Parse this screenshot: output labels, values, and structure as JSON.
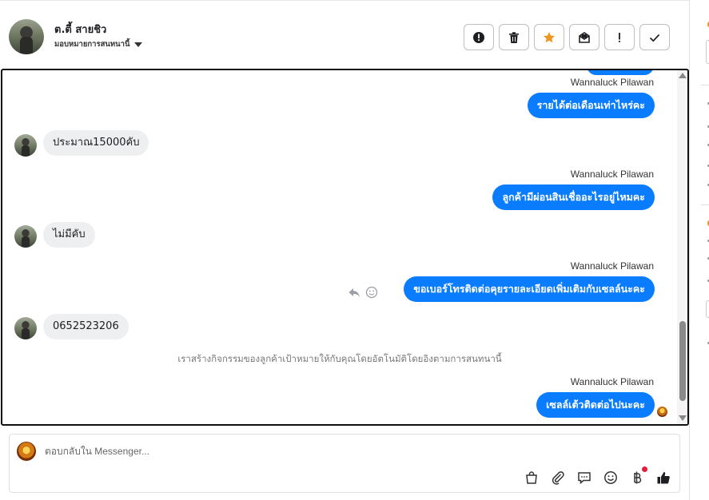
{
  "header": {
    "name": "ต.ตี้ สายชิว",
    "assign_label": "มอบหมายการสนทนานี้",
    "actions": [
      {
        "name": "report-icon"
      },
      {
        "name": "trash-icon"
      },
      {
        "name": "star-icon"
      },
      {
        "name": "mark-unread-icon"
      },
      {
        "name": "exclamation-icon"
      },
      {
        "name": "check-icon"
      }
    ]
  },
  "messages": [
    {
      "type": "outgoing",
      "sender": "Wannaluck Pilawan",
      "text": "รายได้ต่อเดือนเท่าไหร่คะ"
    },
    {
      "type": "incoming",
      "text": "ประมาณ15000คับ"
    },
    {
      "type": "outgoing",
      "sender": "Wannaluck Pilawan",
      "text": "ลูกค้ามีผ่อนสินเชื่ออะไรอยู่ไหมคะ"
    },
    {
      "type": "incoming",
      "text": "ไม่มีคับ"
    },
    {
      "type": "outgoing",
      "sender": "Wannaluck Pilawan",
      "text": "ขอเบอร์โทรติดต่อคุยรายละเอียดเพิ่มเติมกับเซลล์นะคะ"
    },
    {
      "type": "incoming",
      "text": "0652523206"
    },
    {
      "type": "system",
      "text": "เราสร้างกิจกรรมของลูกค้าเป้าหมายให้กับคุณโดยอัตโนมัติโดยอิงตามการสนทนานี้"
    },
    {
      "type": "outgoing",
      "sender": "Wannaluck Pilawan",
      "text": "เซลล์เต้วติดต่อไปนะคะ"
    }
  ],
  "composer": {
    "placeholder": "ตอบกลับใน Messenger..."
  },
  "colors": {
    "outgoing_bubble": "#0a7cff",
    "incoming_bubble": "#eeeff1",
    "star": "#f0961e"
  }
}
